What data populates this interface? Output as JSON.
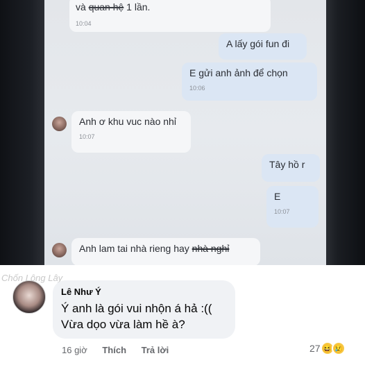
{
  "chat_photo": {
    "messages": [
      {
        "side": "in",
        "text_pre": "và ",
        "text_strike": "quan hệ",
        "text_post": " 1 lần.",
        "time": "10:04"
      },
      {
        "side": "out",
        "text": "A lấy gói fun đi",
        "time": ""
      },
      {
        "side": "out",
        "text": "E gửi anh ảnh để chọn",
        "time": "10:06"
      },
      {
        "side": "in",
        "text": "Anh ơ khu vuc nào nhỉ",
        "time": "10:07"
      },
      {
        "side": "out",
        "text": "Tây hồ r",
        "time": ""
      },
      {
        "side": "out",
        "text": "E",
        "time": "10:07"
      },
      {
        "side": "in",
        "text_pre": "Anh lam tai nhà rieng hay ",
        "text_strike": "nhà nghỉ",
        "text_post": "",
        "time": ""
      }
    ]
  },
  "watermark": "Chốn Lông Lây",
  "comment": {
    "author": "Lê Như Ý",
    "line1": "Ý anh là gói vui nhộn á hả :((",
    "line2": "Vừa dọo vừa làm hề à?",
    "time": "16 giờ",
    "like": "Thích",
    "reply": "Trả lời",
    "reaction_count": "27",
    "reaction_icons": [
      "laugh-emoji",
      "sad-emoji"
    ]
  }
}
